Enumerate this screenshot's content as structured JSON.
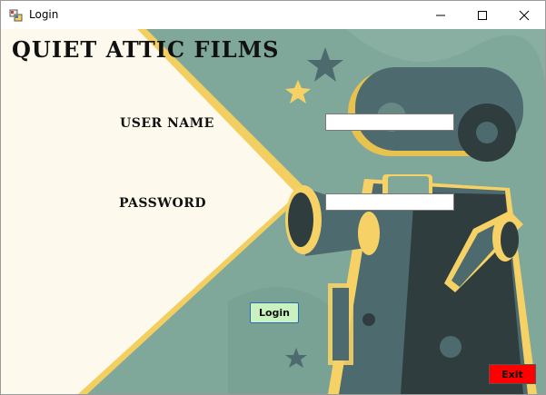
{
  "window": {
    "title": "Login"
  },
  "brand": {
    "name": "QUIET ATTIC FILMS"
  },
  "form": {
    "username_label": "USER NAME",
    "password_label": "PASSWORD",
    "username_value": "",
    "password_value": "",
    "login_label": "Login",
    "exit_label": "Exit"
  },
  "colors": {
    "teal_bg": "#7fa89b",
    "light_beam": "#fdf9ec",
    "accent_yellow": "#f6d266",
    "camera_dark": "#2f3d3e",
    "camera_mid": "#4d6a6e",
    "login_button": "#c9f2c0",
    "exit_button": "#ff0000"
  }
}
